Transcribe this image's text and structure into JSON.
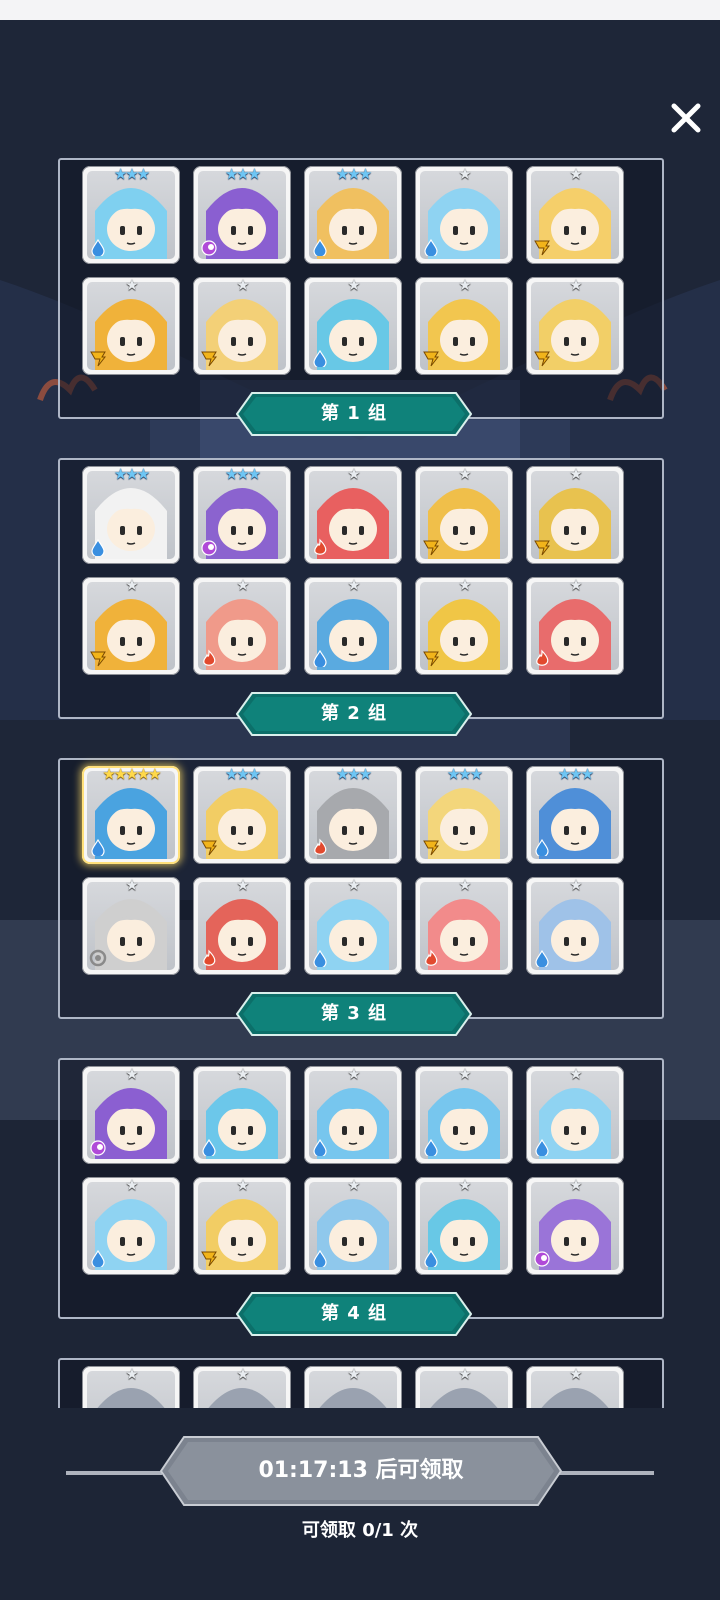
{
  "screen": {
    "background": "#1e2638",
    "accent": "#0e7f77"
  },
  "close_button": {
    "icon": "close-icon"
  },
  "groups": [
    {
      "label": "第 1 组",
      "cards": [
        {
          "stars": 3,
          "tier": "blue",
          "element": "water",
          "hero": "ice-princess",
          "color": "#7fd0f0"
        },
        {
          "stars": 3,
          "tier": "blue",
          "element": "dark",
          "hero": "clock-mage",
          "color": "#8a5fd1"
        },
        {
          "stars": 3,
          "tier": "blue",
          "element": "water",
          "hero": "queen",
          "color": "#f0c060"
        },
        {
          "stars": 1,
          "tier": "silver",
          "element": "water",
          "hero": "blue-hair",
          "color": "#8fd3f2"
        },
        {
          "stars": 1,
          "tier": "silver",
          "element": "light",
          "hero": "cat-girl",
          "color": "#f5cf6a"
        },
        {
          "stars": 1,
          "tier": "silver",
          "element": "light",
          "hero": "block-guy",
          "color": "#f0b23a"
        },
        {
          "stars": 1,
          "tier": "silver",
          "element": "light",
          "hero": "ram-horn",
          "color": "#f3d077"
        },
        {
          "stars": 1,
          "tier": "silver",
          "element": "water",
          "hero": "dragon-head",
          "color": "#68c8e6"
        },
        {
          "stars": 1,
          "tier": "silver",
          "element": "light",
          "hero": "unicorn-knight",
          "color": "#f2c64f"
        },
        {
          "stars": 1,
          "tier": "silver",
          "element": "light",
          "hero": "white-knight",
          "color": "#f2cf67"
        }
      ]
    },
    {
      "label": "第 2 组",
      "cards": [
        {
          "stars": 3,
          "tier": "blue",
          "element": "water",
          "hero": "white-hair",
          "color": "#f2f2f2"
        },
        {
          "stars": 3,
          "tier": "blue",
          "element": "dark",
          "hero": "purple-book",
          "color": "#8b63cf"
        },
        {
          "stars": 1,
          "tier": "silver",
          "element": "fire",
          "hero": "red-blob",
          "color": "#e86060"
        },
        {
          "stars": 1,
          "tier": "silver",
          "element": "light",
          "hero": "fox-staff",
          "color": "#f0bf4a"
        },
        {
          "stars": 1,
          "tier": "silver",
          "element": "light",
          "hero": "gold-helm",
          "color": "#e8c24f"
        },
        {
          "stars": 1,
          "tier": "silver",
          "element": "light",
          "hero": "block-guy",
          "color": "#f0b23a"
        },
        {
          "stars": 1,
          "tier": "silver",
          "element": "fire",
          "hero": "cross-knight",
          "color": "#f09a8a"
        },
        {
          "stars": 1,
          "tier": "silver",
          "element": "water",
          "hero": "blue-totem",
          "color": "#5aaae0"
        },
        {
          "stars": 1,
          "tier": "silver",
          "element": "light",
          "hero": "treasure-box",
          "color": "#f0c646"
        },
        {
          "stars": 1,
          "tier": "silver",
          "element": "fire",
          "hero": "red-knight",
          "color": "#e86c6c"
        }
      ]
    },
    {
      "label": "第 3 组",
      "cards": [
        {
          "stars": 5,
          "tier": "gold",
          "element": "water",
          "hero": "flame-mech",
          "color": "#4aa3e0"
        },
        {
          "stars": 3,
          "tier": "blue",
          "element": "light",
          "hero": "blonde-curls",
          "color": "#f2cd64"
        },
        {
          "stars": 3,
          "tier": "blue",
          "element": "fire",
          "hero": "iron-knight",
          "color": "#a7a9ad"
        },
        {
          "stars": 3,
          "tier": "blue",
          "element": "light",
          "hero": "gold-crown",
          "color": "#f3d67b"
        },
        {
          "stars": 3,
          "tier": "blue",
          "element": "water",
          "hero": "hooded-mage",
          "color": "#4f8fd8"
        },
        {
          "stars": 1,
          "tier": "silver",
          "element": "neutral",
          "hero": "grey-cat",
          "color": "#cfcfcf"
        },
        {
          "stars": 1,
          "tier": "silver",
          "element": "fire",
          "hero": "red-dragon",
          "color": "#e4645a"
        },
        {
          "stars": 1,
          "tier": "silver",
          "element": "water",
          "hero": "cat-ears",
          "color": "#8fd3f2"
        },
        {
          "stars": 1,
          "tier": "silver",
          "element": "fire",
          "hero": "shell-crab",
          "color": "#f28b8b"
        },
        {
          "stars": 1,
          "tier": "silver",
          "element": "water",
          "hero": "visor-knight",
          "color": "#9fc2e8"
        }
      ]
    },
    {
      "label": "第 4 组",
      "cards": [
        {
          "stars": 1,
          "tier": "silver",
          "element": "dark",
          "hero": "purple-blob",
          "color": "#8b5fd1"
        },
        {
          "stars": 1,
          "tier": "silver",
          "element": "water",
          "hero": "blue-dragon",
          "color": "#6cc7ea"
        },
        {
          "stars": 1,
          "tier": "silver",
          "element": "water",
          "hero": "skull-blue",
          "color": "#77c6ee"
        },
        {
          "stars": 1,
          "tier": "silver",
          "element": "water",
          "hero": "skull-blue",
          "color": "#77c6ee"
        },
        {
          "stars": 1,
          "tier": "silver",
          "element": "water",
          "hero": "ram-horn-blue",
          "color": "#8fd3f2"
        },
        {
          "stars": 1,
          "tier": "silver",
          "element": "water",
          "hero": "ram-horn-blue",
          "color": "#8fd3f2"
        },
        {
          "stars": 1,
          "tier": "silver",
          "element": "light",
          "hero": "angel",
          "color": "#f2cd64"
        },
        {
          "stars": 1,
          "tier": "silver",
          "element": "water",
          "hero": "cross-knight-blue",
          "color": "#8fc8ec"
        },
        {
          "stars": 1,
          "tier": "silver",
          "element": "water",
          "hero": "dragon-head",
          "color": "#68c8e6"
        },
        {
          "stars": 1,
          "tier": "silver",
          "element": "dark",
          "hero": "dragon-head-purple",
          "color": "#9a74d8"
        }
      ]
    },
    {
      "label": "",
      "cards": [
        {
          "stars": 1,
          "tier": "silver",
          "element": "none",
          "hero": "partial",
          "color": "#9aa2b0"
        },
        {
          "stars": 1,
          "tier": "silver",
          "element": "none",
          "hero": "partial",
          "color": "#9aa2b0"
        },
        {
          "stars": 1,
          "tier": "silver",
          "element": "none",
          "hero": "partial",
          "color": "#9aa2b0"
        },
        {
          "stars": 1,
          "tier": "silver",
          "element": "none",
          "hero": "partial",
          "color": "#9aa2b0"
        },
        {
          "stars": 1,
          "tier": "silver",
          "element": "none",
          "hero": "partial",
          "color": "#9aa2b0"
        }
      ]
    }
  ],
  "claim": {
    "button_label": "01:17:13 后可领取",
    "count_text": "可领取 0/1 次"
  },
  "element_colors": {
    "water": "#3a8fe0",
    "dark": "#b04ad8",
    "light": "#f2b41a",
    "fire": "#e24a2f",
    "neutral": "#8a8a8a"
  }
}
